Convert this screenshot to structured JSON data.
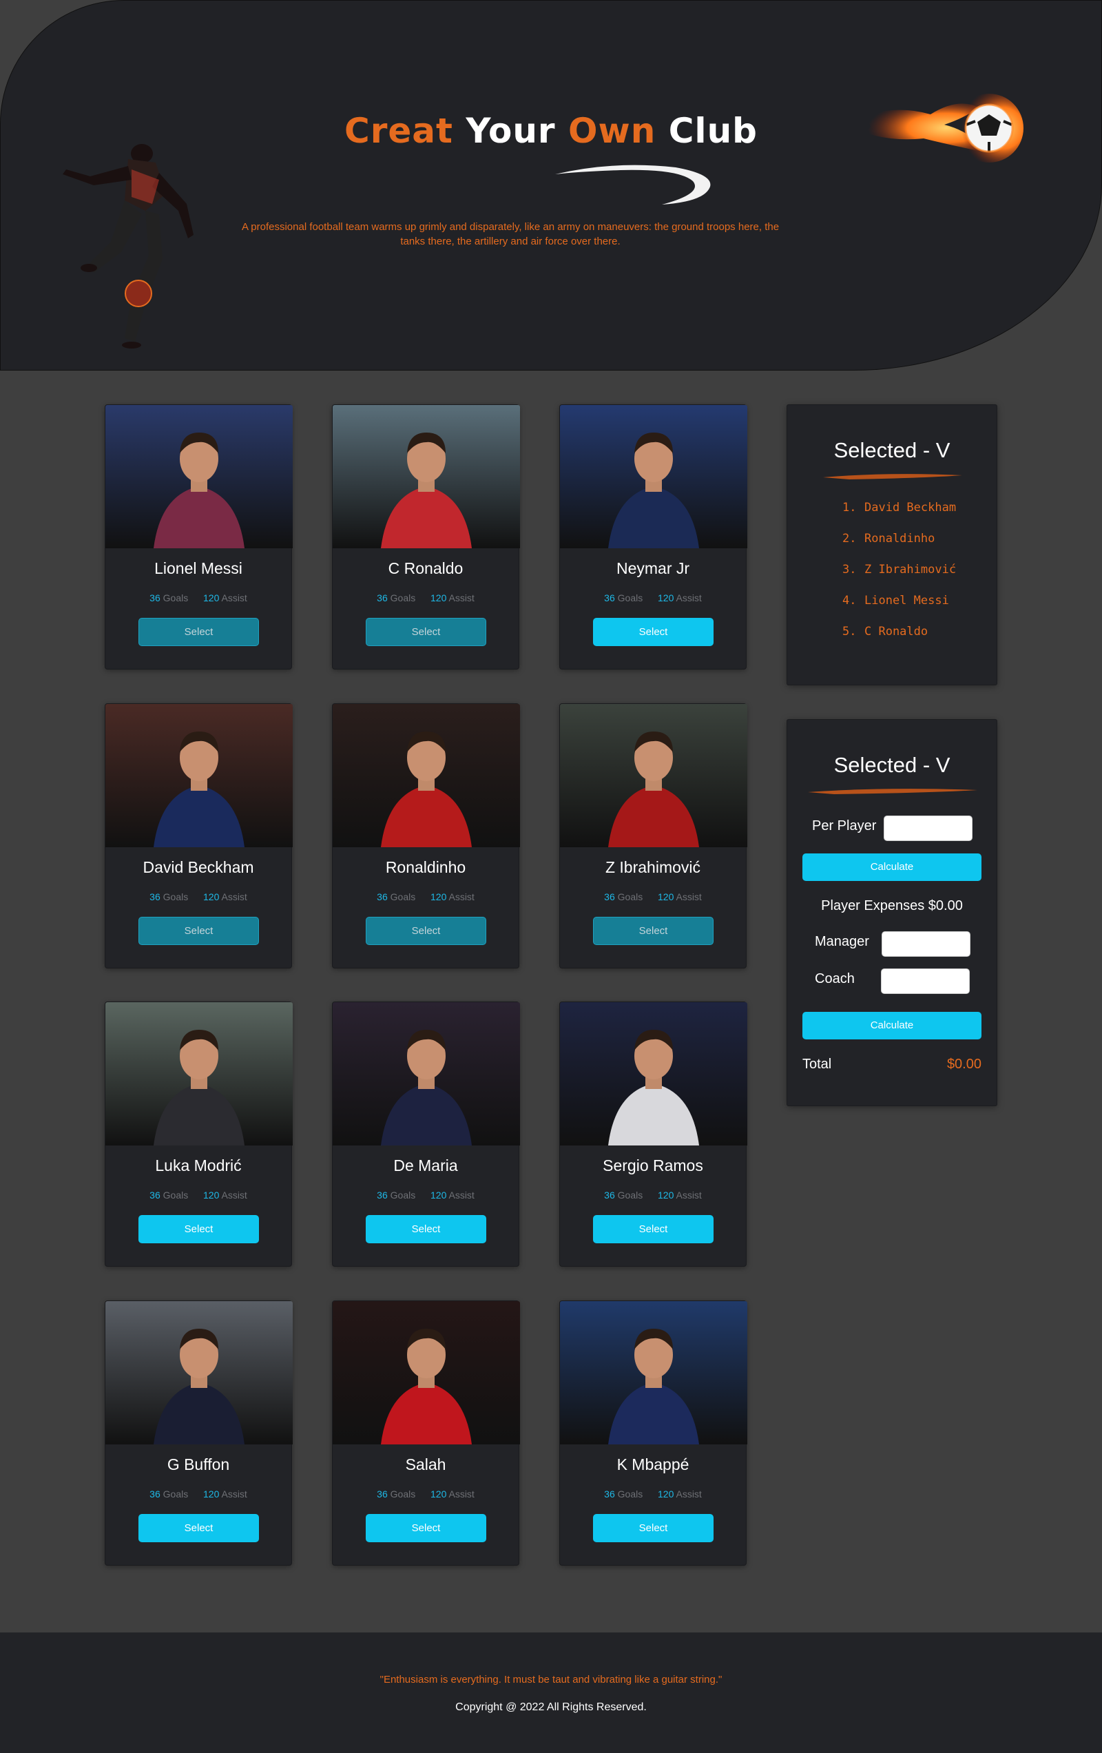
{
  "hero": {
    "title_part1": "Creat",
    "title_part2": "Your",
    "title_part3": "Own",
    "title_part4": "Club",
    "description": "A professional football team warms up grimly and disparately, like an army on maneuvers: the ground troops here, the tanks there, the artillery and air force over there."
  },
  "players": [
    {
      "name": "Lionel Messi",
      "goals": "36",
      "goals_label": "Goals",
      "assist": "120",
      "assist_label": "Assist",
      "button": "Select",
      "selected": true,
      "kit": "#7a2a45",
      "bg": "#2a3a6a"
    },
    {
      "name": "C Ronaldo",
      "goals": "36",
      "goals_label": "Goals",
      "assist": "120",
      "assist_label": "Assist",
      "button": "Select",
      "selected": true,
      "kit": "#c1272d",
      "bg": "#5a6f7a"
    },
    {
      "name": "Neymar Jr",
      "goals": "36",
      "goals_label": "Goals",
      "assist": "120",
      "assist_label": "Assist",
      "button": "Select",
      "selected": false,
      "kit": "#1b2a55",
      "bg": "#243a70"
    },
    {
      "name": "David Beckham",
      "goals": "36",
      "goals_label": "Goals",
      "assist": "120",
      "assist_label": "Assist",
      "button": "Select",
      "selected": true,
      "kit": "#1a2a5c",
      "bg": "#4a2a25"
    },
    {
      "name": "Ronaldinho",
      "goals": "36",
      "goals_label": "Goals",
      "assist": "120",
      "assist_label": "Assist",
      "button": "Select",
      "selected": true,
      "kit": "#b51b1b",
      "bg": "#2a1e1c"
    },
    {
      "name": "Z Ibrahimović",
      "goals": "36",
      "goals_label": "Goals",
      "assist": "120",
      "assist_label": "Assist",
      "button": "Select",
      "selected": true,
      "kit": "#a51818",
      "bg": "#3b423c"
    },
    {
      "name": "Luka Modrić",
      "goals": "36",
      "goals_label": "Goals",
      "assist": "120",
      "assist_label": "Assist",
      "button": "Select",
      "selected": false,
      "kit": "#2b2b30",
      "bg": "#5a6660"
    },
    {
      "name": "De Maria",
      "goals": "36",
      "goals_label": "Goals",
      "assist": "120",
      "assist_label": "Assist",
      "button": "Select",
      "selected": false,
      "kit": "#1d2240",
      "bg": "#2a2230"
    },
    {
      "name": "Sergio Ramos",
      "goals": "36",
      "goals_label": "Goals",
      "assist": "120",
      "assist_label": "Assist",
      "button": "Select",
      "selected": false,
      "kit": "#d8d8dc",
      "bg": "#1e2440"
    },
    {
      "name": "G Buffon",
      "goals": "36",
      "goals_label": "Goals",
      "assist": "120",
      "assist_label": "Assist",
      "button": "Select",
      "selected": false,
      "kit": "#1a1e33",
      "bg": "#5a5f66"
    },
    {
      "name": "Salah",
      "goals": "36",
      "goals_label": "Goals",
      "assist": "120",
      "assist_label": "Assist",
      "button": "Select",
      "selected": false,
      "kit": "#c0161d",
      "bg": "#241616"
    },
    {
      "name": "K Mbappé",
      "goals": "36",
      "goals_label": "Goals",
      "assist": "120",
      "assist_label": "Assist",
      "button": "Select",
      "selected": false,
      "kit": "#1c2a5c",
      "bg": "#203a6a"
    }
  ],
  "selected_panel": {
    "title": "Selected - V",
    "items": [
      {
        "index": "1.",
        "name": "David Beckham"
      },
      {
        "index": "2.",
        "name": "Ronaldinho"
      },
      {
        "index": "3.",
        "name": "Z Ibrahimović"
      },
      {
        "index": "4.",
        "name": "Lionel Messi"
      },
      {
        "index": "5.",
        "name": "C Ronaldo"
      }
    ]
  },
  "budget_panel": {
    "title": "Selected - V",
    "per_player_label": "Per Player",
    "calculate_label": "Calculate",
    "player_expenses_label": "Player Expenses $0.00",
    "manager_label": "Manager",
    "coach_label": "Coach",
    "calculate_total_label": "Calculate",
    "total_label": "Total",
    "total_value": "$0.00"
  },
  "footer": {
    "quote": "\"Enthusiasm is everything. It must be taut and vibrating like a guitar string.\"",
    "copyright": "Copyright @ 2022 All Rights Reserved."
  },
  "colors": {
    "accent_orange": "#e56b1f",
    "accent_cyan": "#0ec6ef",
    "panel_bg": "#222327",
    "page_bg": "#3f3f3f"
  }
}
